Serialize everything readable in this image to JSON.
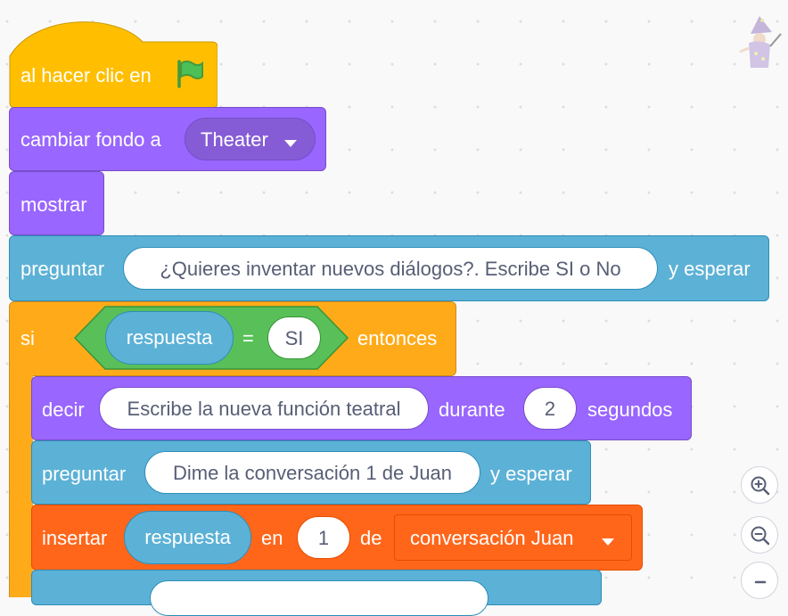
{
  "script": {
    "hat": {
      "label": "al hacer clic en",
      "icon": "green-flag-icon"
    },
    "backdrop": {
      "label": "cambiar fondo a",
      "value": "Theater"
    },
    "show": {
      "label": "mostrar"
    },
    "ask1": {
      "label": "preguntar",
      "question": "¿Quieres inventar nuevos diálogos?. Escribe SI o No",
      "suffix": "y esperar"
    },
    "if": {
      "label": "si",
      "lhs": "respuesta",
      "op": "=",
      "rhs": "SI",
      "then": "entonces"
    },
    "say": {
      "label": "decir",
      "message": "Escribe la nueva función teatral",
      "during": "durante",
      "secs": "2",
      "unit": "segundos"
    },
    "ask2": {
      "label": "preguntar",
      "question": "Dime la conversación 1 de Juan",
      "suffix": "y esperar"
    },
    "insert": {
      "label": "insertar",
      "item": "respuesta",
      "at": "en",
      "index": "1",
      "of": "de",
      "list": "conversación Juan"
    }
  },
  "zoom": {
    "in": "zoom-in-icon",
    "out": "zoom-out-icon",
    "reset": "zoom-reset-icon"
  },
  "colors": {
    "events": "#ffbf00",
    "looks": "#9966ff",
    "sensing": "#5cb1d6",
    "control": "#ffab19",
    "operators": "#59c059",
    "lists": "#ff661a"
  }
}
